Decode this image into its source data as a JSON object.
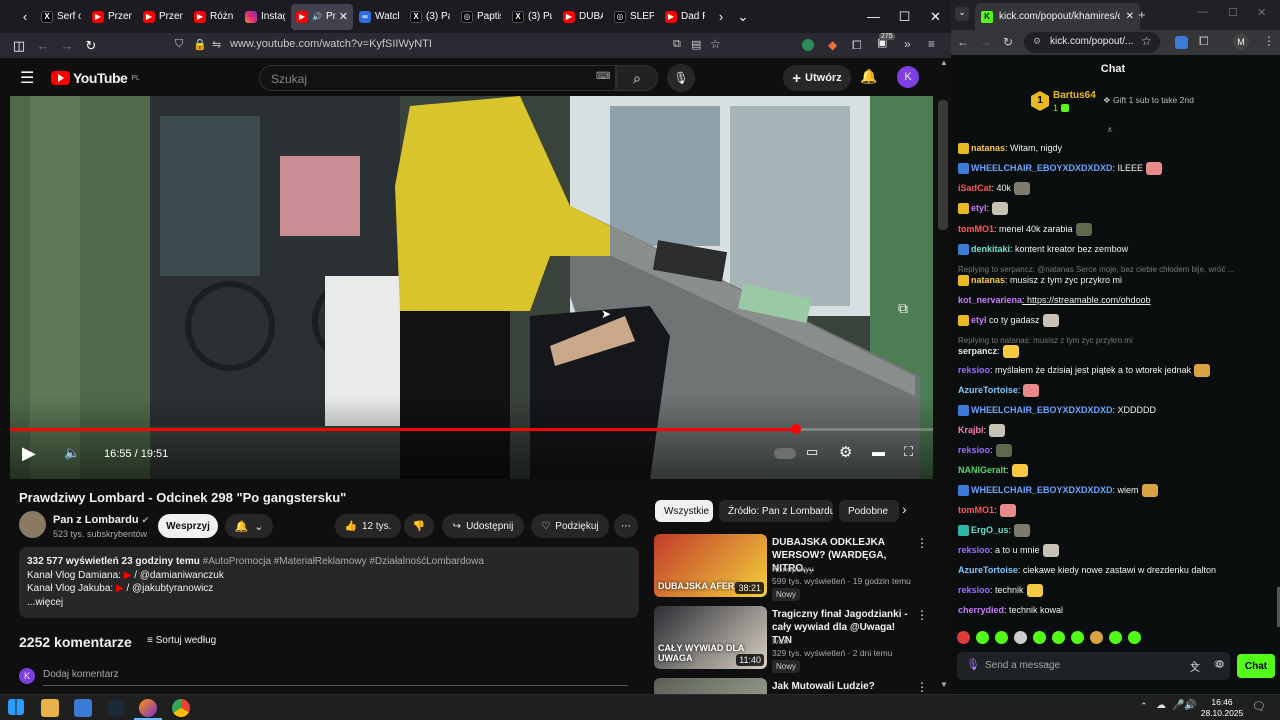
{
  "firefox": {
    "tabs": [
      {
        "title": "Serf o",
        "icon": "x-logo"
      },
      {
        "title": "Przem",
        "icon": "youtube-logo"
      },
      {
        "title": "Przem",
        "icon": "youtube-logo"
      },
      {
        "title": "Różni",
        "icon": "youtube-logo"
      },
      {
        "title": "Instag",
        "icon": "instagram-logo"
      },
      {
        "title": "Pra",
        "icon": "youtube-logo",
        "active": true
      },
      {
        "title": "Watch",
        "icon": "watch-logo"
      },
      {
        "title": "(3) Pa",
        "icon": "x-logo"
      },
      {
        "title": "Paptis",
        "icon": "circle-logo"
      },
      {
        "title": "(3) Pu",
        "icon": "x-logo"
      },
      {
        "title": "DUBA",
        "icon": "youtube-logo"
      },
      {
        "title": "ŚLEPA",
        "icon": "circle-logo"
      },
      {
        "title": "Dad P",
        "icon": "youtube-logo"
      }
    ],
    "url": "www.youtube.com/watch?v=KyfSIIWyNTI",
    "badge_count": "275"
  },
  "youtube": {
    "logo_text": "YouTube",
    "logo_region": "PL",
    "search_placeholder": "Szukaj",
    "create_label": "Utwórz",
    "avatar_letter": "K",
    "video": {
      "time_current": "16:55",
      "time_total": "19:51",
      "progress": 0.852
    },
    "title": "Prawdziwy Lombard - Odcinek 298 \"Po gangstersku\"",
    "channel": "Pan z Lombardu",
    "subscribers": "523 tys. subskrybentów",
    "support_label": "Wesprzyj",
    "likes": "12 tys.",
    "share_label": "Udostępnij",
    "thanks_label": "Podziękuj",
    "description": {
      "stats": "332 577 wyświetleń  23 godziny temu",
      "tags": "#AutoPromocja #MateriałReklamowy #DziałalnośćLombardowa",
      "line1_label": "Kanał Vlog Damiana:",
      "line1_handle": "/ @damianiwanczuk",
      "line2_label": "Kanał Vlog Jakuba:",
      "line2_handle": "/ @jakubtyranowicz",
      "more": "...więcej"
    },
    "comments_count": "2252 komentarze",
    "sort_label": "Sortuj według",
    "add_comment": "Dodaj komentarz",
    "chips": [
      "Wszystkie",
      "Źródło: Pan z Lombardu",
      "Podobne"
    ],
    "recommended": [
      {
        "title": "DUBAJSKA ODKLEJKA WERSOW? (WARDĘGA, NITRO,...",
        "channel": "Konopskyy",
        "meta": "599 tys. wyświetleń · 19 godzin temu",
        "badge": "Nowy",
        "duration": "38:21",
        "thumb_text": "DUBAJSKA AFERA"
      },
      {
        "title": "Tragiczny finał Jagodzianki - cały wywiad dla @Uwaga! TVN",
        "channel": "Ivan",
        "meta": "329 tys. wyświetleń · 2 dni temu",
        "badge": "Nowy",
        "duration": "11:40",
        "thumb_text": "CAŁY WYWIAD DLA UWAGA"
      },
      {
        "title": "Jak Mutowali Ludzie? Więzień",
        "channel": "",
        "meta": "",
        "badge": "",
        "duration": "",
        "thumb_text": ""
      }
    ]
  },
  "chrome": {
    "tab_title": "kick.com/popout/khamires/cha",
    "url": "kick.com/popout/...",
    "profile_letter": "M"
  },
  "kick": {
    "header": "Chat",
    "gifter": {
      "name": "Bartus64",
      "rank": "1",
      "count": "1"
    },
    "gift_label": "Gift 1 sub to take 2nd",
    "messages": [
      {
        "user": "natanas",
        "text": ": Witam, nigdy",
        "color": "#f7c842"
      },
      {
        "user": "WHEELCHAIR_EBOYXDXDXDXD",
        "text": ": ILEEE",
        "color": "#6aa4ff"
      },
      {
        "user": "iSadCat",
        "text": ": 40k",
        "color": "#ff5757"
      },
      {
        "user": "etyl",
        "text": ":",
        "color": "#c97bff"
      },
      {
        "user": "tomMO1",
        "text": ": menel 40k zarabia",
        "color": "#ff5757"
      },
      {
        "user": "denkitaki",
        "text": ": kontent kreator bez zembow",
        "color": "#6ee0d0"
      },
      {
        "user": "",
        "text": "Replying to serpancz: @natanas Serce moje, bez ciebie chłodem bije, wróć ...",
        "color": "#777",
        "reply": true
      },
      {
        "user": "natanas",
        "text": ": musisz z tym zyc przykro mi",
        "color": "#f7c842"
      },
      {
        "user": "kot_nervariena",
        "text": ": https://streamable.com/ohdoob",
        "color": "#c97bff"
      },
      {
        "user": "etyl",
        "text": " co ty gadasz",
        "color": "#c97bff"
      },
      {
        "user": "",
        "text": "Replying to natanas: musisz z tym zyc przykro mi",
        "color": "#777",
        "reply": true
      },
      {
        "user": "serpancz",
        "text": ":",
        "color": "#e8e8e8"
      },
      {
        "user": "reksioo",
        "text": ": myślałem że dzisiaj jest piątek a to wtorek jednak",
        "color": "#9b6bff"
      },
      {
        "user": "AzureTortoise",
        "text": ":",
        "color": "#7ec8ff"
      },
      {
        "user": "WHEELCHAIR_EBOYXDXDXDXD",
        "text": ": XDDDDD",
        "color": "#6aa4ff"
      },
      {
        "user": "Krajbi",
        "text": ":",
        "color": "#ff7ab0"
      },
      {
        "user": "reksioo",
        "text": ":",
        "color": "#9b6bff"
      },
      {
        "user": "NANIGeralt",
        "text": ":",
        "color": "#59d46b"
      },
      {
        "user": "WHEELCHAIR_EBOYXDXDXDXD",
        "text": ": wiem",
        "color": "#6aa4ff"
      },
      {
        "user": "tomMO1",
        "text": ":",
        "color": "#ff5757"
      },
      {
        "user": "ErgO_us",
        "text": ":",
        "color": "#6ee0d0"
      },
      {
        "user": "reksioo",
        "text": ": a to u mnie",
        "color": "#9b6bff"
      },
      {
        "user": "AzureTortoise",
        "text": ": ciekawe kiedy nowe  zastawi w drezdenku dalton",
        "color": "#7ec8ff"
      },
      {
        "user": "reksioo",
        "text": ": technik",
        "color": "#9b6bff"
      },
      {
        "user": "cherrydied",
        "text": ": technik kowal",
        "color": "#c97bff"
      }
    ],
    "input_placeholder": "Send a message",
    "send_label": "Chat"
  },
  "taskbar": {
    "time": "16:46",
    "date": "28.10.2025"
  }
}
